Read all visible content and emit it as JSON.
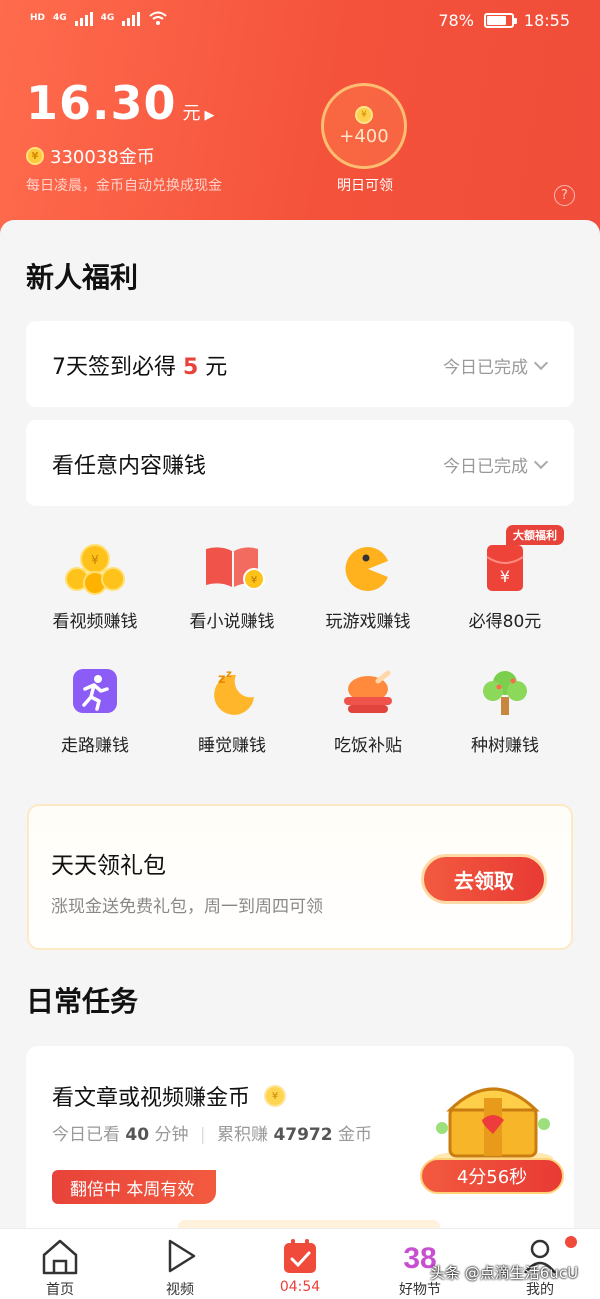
{
  "status_bar": {
    "battery": "78%",
    "time": "18:55",
    "battery_level": 0.78,
    "network_left": "HD",
    "network_right": "4G"
  },
  "wallet": {
    "amount": "16.30",
    "unit": "元",
    "coins": "330038金币",
    "note": "每日凌晨，金币自动兑换成现金",
    "bonus": "+400",
    "bonus_label": "明日可领",
    "coin_glyph": "¥"
  },
  "new_user": {
    "title": "新人福利",
    "checkin": {
      "prefix": "7天签到必得 ",
      "highlight": "5",
      "suffix": " 元",
      "status": "今日已完成"
    },
    "browse": {
      "title": "看任意内容赚钱",
      "status": "今日已完成"
    },
    "grid": [
      {
        "label": "看视频赚钱",
        "icon": "coins-icon"
      },
      {
        "label": "看小说赚钱",
        "icon": "book-icon"
      },
      {
        "label": "玩游戏赚钱",
        "icon": "pacman-icon"
      },
      {
        "label": "必得80元",
        "icon": "red-envelope-icon",
        "tag": "大额福利"
      },
      {
        "label": "走路赚钱",
        "icon": "running-icon"
      },
      {
        "label": "睡觉赚钱",
        "icon": "moon-icon"
      },
      {
        "label": "吃饭补贴",
        "icon": "roast-chicken-icon"
      },
      {
        "label": "种树赚钱",
        "icon": "tree-icon"
      }
    ]
  },
  "gift": {
    "title": "天天领礼包",
    "subtitle": "涨现金送免费礼包，周一到周四可领",
    "button": "去领取"
  },
  "daily": {
    "title": "日常任务",
    "task": {
      "title": "看文章或视频赚金币",
      "stats_prefix": "今日已看 ",
      "minutes": "40",
      "minutes_unit": " 分钟",
      "total_prefix": "累积赚 ",
      "total": "47972",
      "total_unit": " 金币",
      "boost": "翻倍中 本周有效",
      "timer": "4分56秒"
    }
  },
  "bottom_nav": [
    {
      "label": "首页",
      "icon": "home-icon"
    },
    {
      "label": "视频",
      "icon": "play-icon"
    },
    {
      "label": "04:54",
      "icon": "calendar-check-icon"
    },
    {
      "label": "好物节",
      "icon": "38-festival-icon"
    },
    {
      "label": "我的",
      "icon": "profile-icon"
    }
  ],
  "watermark": "头条 @点滴生活6ucU",
  "colors": {
    "accent": "#e8433a",
    "header": "#f4523b"
  }
}
